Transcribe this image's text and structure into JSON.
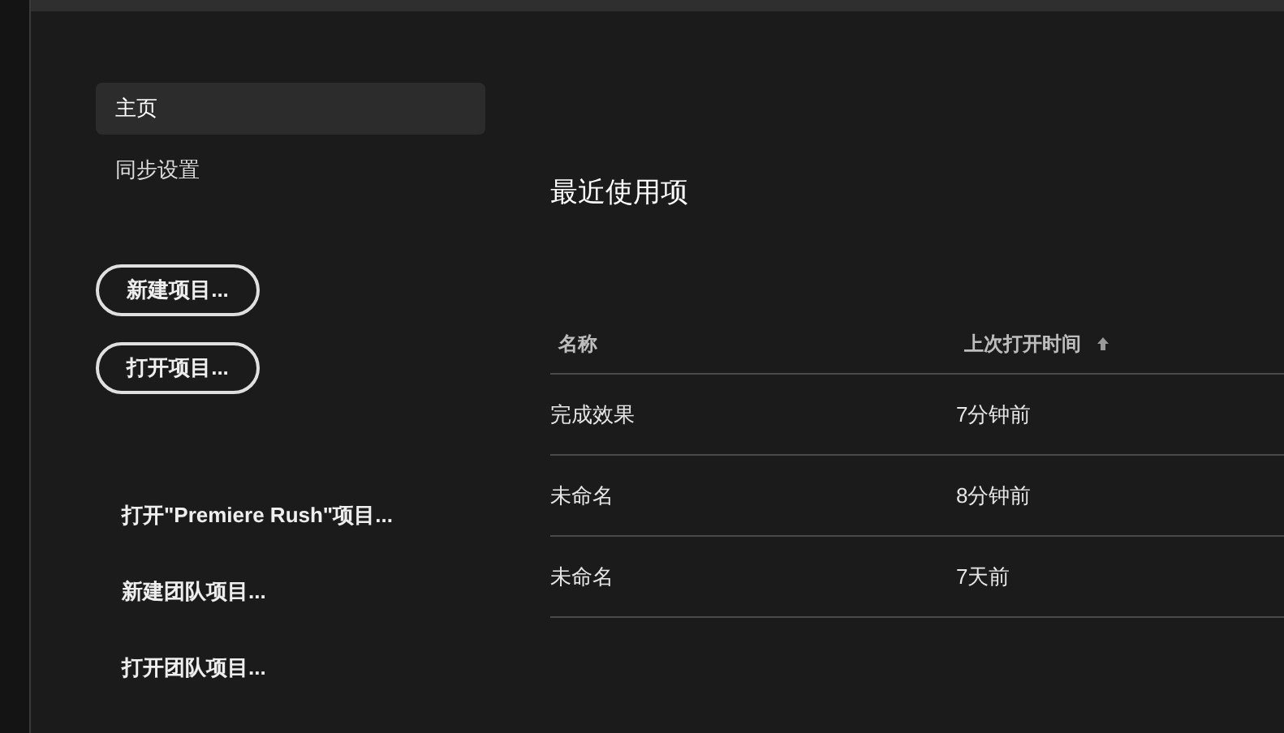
{
  "sidebar": {
    "items": [
      {
        "label": "主页",
        "selected": true
      },
      {
        "label": "同步设置",
        "selected": false
      }
    ],
    "buttons": [
      "新建项目...",
      "打开项目..."
    ],
    "links": [
      "打开\"Premiere Rush\"项目...",
      "新建团队项目...",
      "打开团队项目..."
    ]
  },
  "recent": {
    "title": "最近使用项",
    "table": {
      "columns": [
        {
          "label": "名称",
          "sorted": false
        },
        {
          "label": "上次打开时间",
          "sorted": true
        }
      ],
      "rows": [
        [
          "完成效果",
          "7分钟前"
        ],
        [
          "未命名",
          "8分钟前"
        ],
        [
          "未命名",
          "7天前"
        ]
      ]
    }
  }
}
